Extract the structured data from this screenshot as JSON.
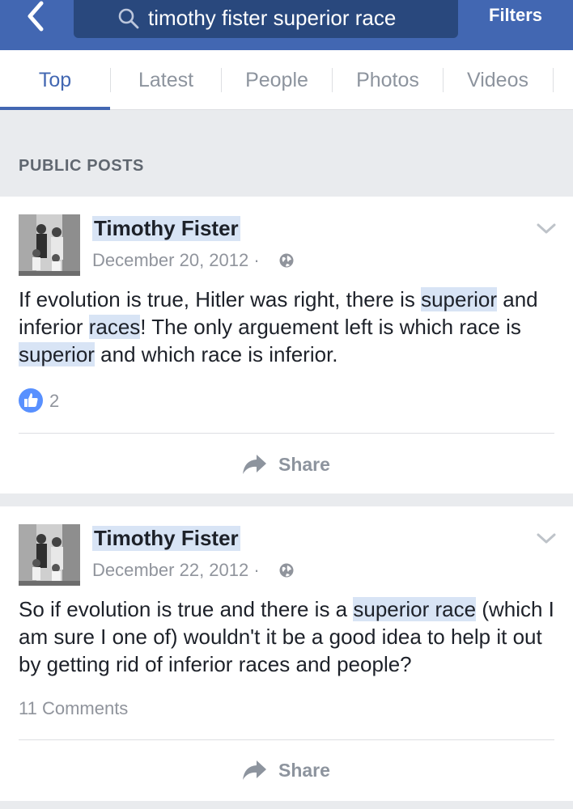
{
  "header": {
    "search_query": "timothy fister superior race",
    "filters_label": "Filters"
  },
  "tabs": [
    "Top",
    "Latest",
    "People",
    "Photos",
    "Videos"
  ],
  "section_label": "PUBLIC POSTS",
  "posts": [
    {
      "author": "Timothy Fister",
      "date": "December 20, 2012 ·",
      "text_parts": [
        {
          "t": "If evolution is true, Hitler was right, there is ",
          "hl": false
        },
        {
          "t": "superior",
          "hl": true
        },
        {
          "t": " and inferior ",
          "hl": false
        },
        {
          "t": "races",
          "hl": true
        },
        {
          "t": "!  The only arguement left is which race is ",
          "hl": false
        },
        {
          "t": "superior",
          "hl": true
        },
        {
          "t": " and which race is inferior.",
          "hl": false
        }
      ],
      "like_count": "2",
      "share_label": "Share"
    },
    {
      "author": "Timothy Fister",
      "date": "December 22, 2012 ·",
      "text_parts": [
        {
          "t": "So if evolution is true and there is a ",
          "hl": false
        },
        {
          "t": "superior race",
          "hl": true
        },
        {
          "t": " (which I am sure I one of) wouldn't it be a good idea to help it out by getting rid of inferior races and people?",
          "hl": false
        }
      ],
      "comments_label": "11 Comments",
      "share_label": "Share"
    }
  ],
  "colors": {
    "brand": "#4267b2",
    "search_bg": "#29487d",
    "highlight": "#d8e4f5",
    "like_blue": "#5890ff"
  },
  "icons": [
    "back-arrow-icon",
    "search-icon",
    "globe-icon",
    "chevron-down-icon",
    "like-icon",
    "share-icon"
  ]
}
